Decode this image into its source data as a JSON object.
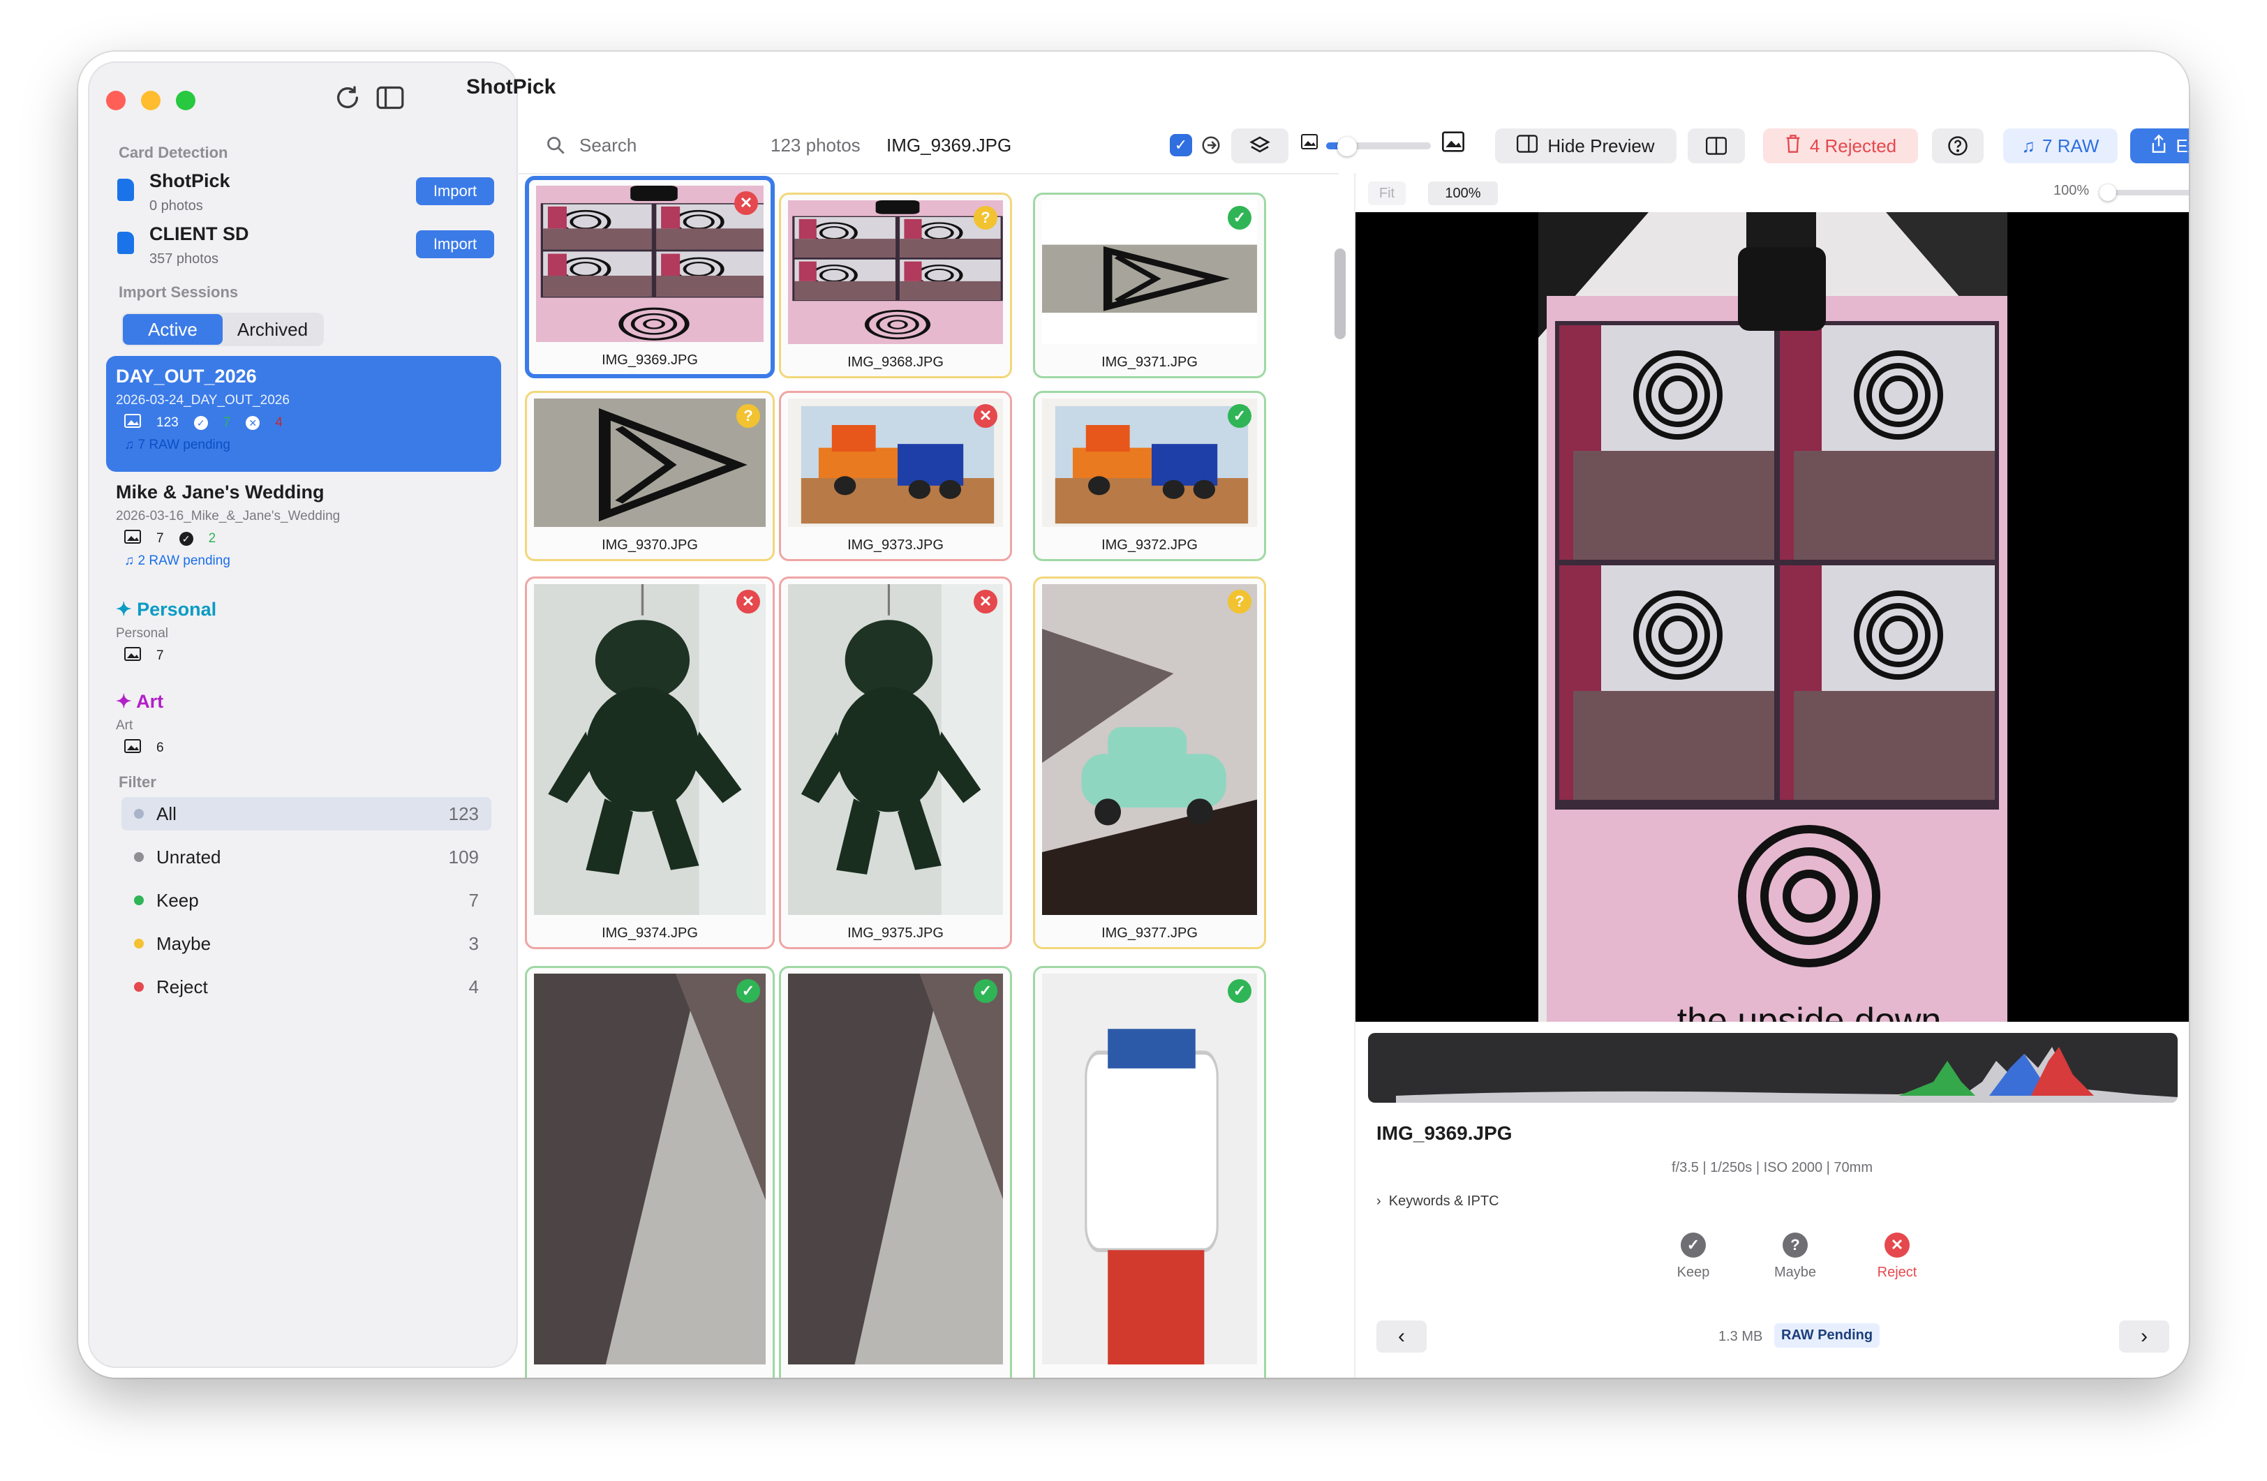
{
  "app": {
    "title": "ShotPick"
  },
  "sidebar": {
    "card_detection_title": "Card Detection",
    "cards": [
      {
        "name": "ShotPick",
        "count": "0 photos",
        "button": "Import"
      },
      {
        "name": "CLIENT SD",
        "count": "357 photos",
        "button": "Import"
      }
    ],
    "import_sessions_title": "Import Sessions",
    "tabs": {
      "active": "Active",
      "archived": "Archived"
    },
    "sessions": [
      {
        "title": "DAY_OUT_2026",
        "sub": "2026-03-24_DAY_OUT_2026",
        "photos": "123",
        "keep": "7",
        "reject": "4",
        "raw": "7 RAW pending"
      },
      {
        "title": "Mike & Jane's Wedding",
        "sub": "2026-03-16_Mike_&_Jane's_Wedding",
        "photos": "7",
        "keep": "2",
        "raw": "2 RAW pending"
      }
    ],
    "pinned": [
      {
        "title": "Personal",
        "sub": "Personal",
        "photos": "7",
        "color": "#0b9bc4"
      },
      {
        "title": "Art",
        "sub": "Art",
        "photos": "6",
        "color": "#b21fc8"
      }
    ],
    "filter_title": "Filter",
    "filters": [
      {
        "label": "All",
        "count": "123",
        "color": "#a9b3c9"
      },
      {
        "label": "Unrated",
        "count": "109",
        "color": "#8e8e93"
      },
      {
        "label": "Keep",
        "count": "7",
        "color": "#2fb556"
      },
      {
        "label": "Maybe",
        "count": "3",
        "color": "#f2c230"
      },
      {
        "label": "Reject",
        "count": "4",
        "color": "#e5484d"
      }
    ]
  },
  "toolbar": {
    "search_placeholder": "Search",
    "photo_count": "123 photos",
    "current_file": "IMG_9369.JPG",
    "hide_preview": "Hide Preview",
    "rejected": "4 Rejected",
    "raw": "7 RAW",
    "export": "Export"
  },
  "grid": [
    {
      "name": "IMG_9369.JPG",
      "status": "reject",
      "border": "#3b7be8",
      "kind": "booth"
    },
    {
      "name": "IMG_9368.JPG",
      "status": "maybe",
      "border": "#f2d77a",
      "kind": "booth"
    },
    {
      "name": "IMG_9371.JPG",
      "status": "keep",
      "border": "#9fd8a5",
      "kind": "triangle-wide"
    },
    {
      "name": "IMG_9370.JPG",
      "status": "maybe",
      "border": "#f2d77a",
      "kind": "triangle"
    },
    {
      "name": "IMG_9373.JPG",
      "status": "reject",
      "border": "#f0a5a5",
      "kind": "truck"
    },
    {
      "name": "IMG_9372.JPG",
      "status": "keep",
      "border": "#9fd8a5",
      "kind": "truck"
    },
    {
      "name": "IMG_9374.JPG",
      "status": "reject",
      "border": "#f0a5a5",
      "kind": "plush"
    },
    {
      "name": "IMG_9375.JPG",
      "status": "reject",
      "border": "#f0a5a5",
      "kind": "plush"
    },
    {
      "name": "IMG_9377.JPG",
      "status": "maybe",
      "border": "#f2d77a",
      "kind": "car"
    },
    {
      "name": "",
      "status": "keep",
      "border": "#9fd8a5",
      "kind": "dark"
    },
    {
      "name": "",
      "status": "keep",
      "border": "#9fd8a5",
      "kind": "dark"
    },
    {
      "name": "",
      "status": "keep",
      "border": "#9fd8a5",
      "kind": "lego"
    }
  ],
  "preview": {
    "fit": "Fit",
    "zoom": "100%",
    "zoom_right": "100%",
    "zoom_level": 0.05,
    "filename": "IMG_9369.JPG",
    "exif": "f/3.5 | 1/250s | ISO 2000 | 70mm",
    "keywords": "Keywords & IPTC",
    "keep": "Keep",
    "maybe": "Maybe",
    "reject": "Reject",
    "size": "1.3 MB",
    "raw_badge": "RAW Pending",
    "booth_caption": "the upside down"
  }
}
